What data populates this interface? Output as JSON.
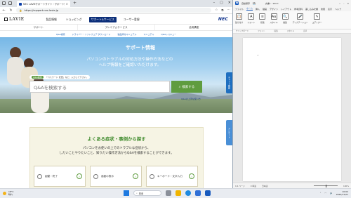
{
  "browser": {
    "tab_title": "NEC LAVIEサポートサイト・サポート情報",
    "url": "https://support.nec-lavie.jp",
    "newtab_glyph": "+",
    "close_glyph": "×"
  },
  "site": {
    "logo": "LAVIE",
    "brand": "NEC",
    "gnav": [
      "製品情報",
      "ショッピング",
      "サポート&サービス",
      "ユーザー登録"
    ],
    "subnav": [
      "サポート",
      "プレミアムサービス",
      "活用講座"
    ],
    "quicklinks": [
      "Q&A検索",
      "ドライバー・ソフトウェア ダウンロード",
      "製品添付マニュアル",
      "マニュアル",
      "Q&Aレスキュー"
    ],
    "hero": {
      "title": "サポート情報",
      "desc_line1": "パソコンのトラブルの対処方法や操作方法などの",
      "desc_line2": "ヘルプ情報をご確認いただけます。",
      "tip_label": "Q&A検索",
      "tip_text": "「パスワード 変更」など、入力して下さい。",
      "search_placeholder": "Q&Aを検索する",
      "search_button": "検索する",
      "link": "Q&Aの上手な使い方"
    },
    "side_tab_top": "チャット相談",
    "side_tab_bottom": "アンケート",
    "faq": {
      "title": "よくある症状・事例から探す",
      "desc_line1": "パソコンをお使いの上でのトラブルな症状から、",
      "desc_line2": "したいことやりたいこと、知りたい操作方法からQ&Aを検索することができます。",
      "cards": [
        {
          "label": "起動・終了"
        },
        {
          "label": "画面の表示"
        },
        {
          "label": "キーボード・文字入力"
        }
      ]
    }
  },
  "word": {
    "logo": "W",
    "doc_title": "文書1 - Word",
    "autosave_label": "自動保存",
    "tabs": [
      "ファイル",
      "ホーム",
      "挿入",
      "描画",
      "デザイン",
      "レイアウト",
      "参考資料",
      "差し込み文書",
      "校閲",
      "表示",
      "ヘルプ"
    ],
    "ribbon": [
      {
        "label": "貼り付け",
        "glyph": "📋"
      },
      {
        "label": "フォント",
        "glyph": "A"
      },
      {
        "label": "段落",
        "glyph": "≡"
      },
      {
        "label": "スタイル",
        "glyph": "Aa"
      },
      {
        "label": "編集",
        "glyph": "🔍"
      },
      {
        "label": "ディクテーション",
        "glyph": "🎤"
      },
      {
        "label": "エディター",
        "glyph": "✎"
      }
    ],
    "ribbon_groups": [
      "クリップボード",
      "フォント",
      "段落",
      "スタイル",
      "音声"
    ],
    "status_page": "1/1 ページ",
    "status_words": "0 単語",
    "status_lang": "日本語",
    "zoom": "100%"
  },
  "taskbar": {
    "weather_temp": "18°C",
    "weather_desc": "晴れ",
    "search_label": "検索",
    "time": "10:02",
    "date": "2024/11/21"
  },
  "colors": {
    "nec_blue": "#0b2f8a",
    "green": "#5f9c3f",
    "word_blue": "#185abd"
  }
}
